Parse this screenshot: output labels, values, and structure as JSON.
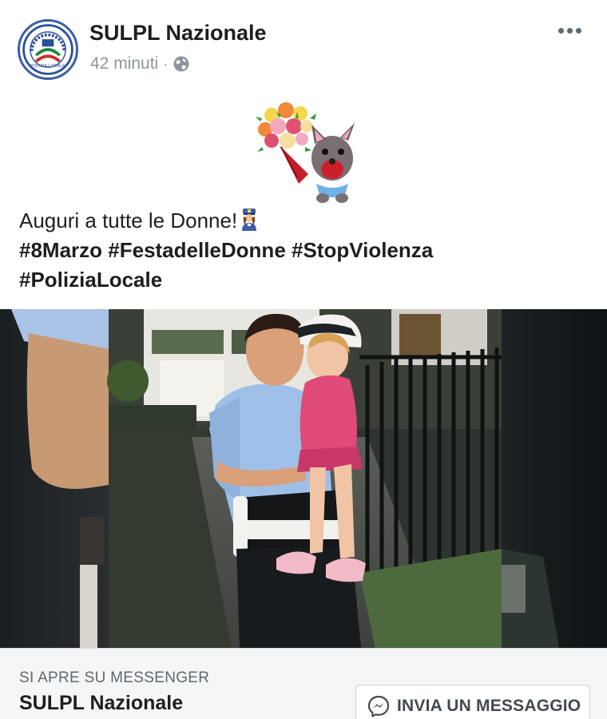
{
  "post": {
    "page_name": "SULPL Nazionale",
    "timestamp": "42 minuti",
    "separator": "·",
    "privacy_icon": "globe-icon",
    "more_icon": "more-options-icon",
    "avatar_logo_text": "POLIZIA LOCALE",
    "sticker": "flower-bouquet-dog-sticker",
    "text_line": "Auguri a tutte le Donne!",
    "text_emoji": "police-officer-woman-emoji",
    "hashtags_line1": "#8Marzo #FestadelleDonne #StopViolenza",
    "hashtags_line2": "#PoliziaLocale",
    "photo": "policewoman-holding-child-photo"
  },
  "cta": {
    "subtitle": "SI APRE SU MESSENGER",
    "title": "SULPL Nazionale",
    "button_label": "INVIA UN MESSAGGIO",
    "button_icon": "messenger-icon"
  },
  "colors": {
    "name_text": "#1c1e21",
    "meta_text": "#8d949e",
    "cta_background": "#f5f6f7",
    "avatar_border": "#3b5fa8"
  }
}
